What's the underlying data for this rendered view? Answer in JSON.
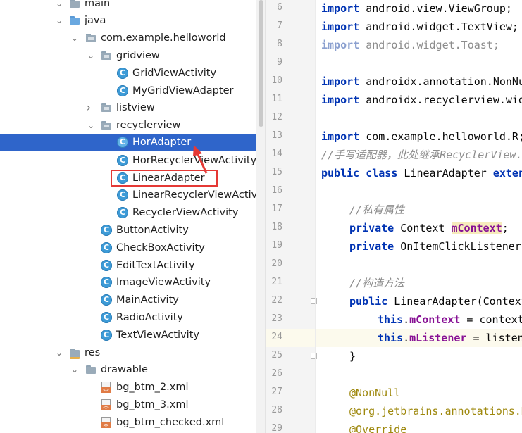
{
  "project_tree": {
    "items": [
      {
        "label": "main",
        "icon": "main-folder-icon",
        "expanded": true
      },
      {
        "label": "java",
        "icon": "java-source-folder-icon",
        "expanded": true
      },
      {
        "label": "com.example.helloworld",
        "icon": "package-icon",
        "expanded": true
      },
      {
        "label": "gridview",
        "icon": "package-icon",
        "expanded": true
      },
      {
        "label": "GridViewActivity",
        "icon": "class-icon"
      },
      {
        "label": "MyGridViewAdapter",
        "icon": "class-icon"
      },
      {
        "label": "listview",
        "icon": "package-icon",
        "expanded": false
      },
      {
        "label": "recyclerview",
        "icon": "package-icon",
        "expanded": true
      },
      {
        "label": "HorAdapter",
        "icon": "class-icon",
        "selected": true
      },
      {
        "label": "HorRecyclerViewActivity",
        "icon": "class-icon"
      },
      {
        "label": "LinearAdapter",
        "icon": "class-icon",
        "highlighted": true
      },
      {
        "label": "LinearRecyclerViewActivity",
        "icon": "class-icon"
      },
      {
        "label": "RecyclerViewActivity",
        "icon": "class-icon"
      },
      {
        "label": "ButtonActivity",
        "icon": "class-icon"
      },
      {
        "label": "CheckBoxActivity",
        "icon": "class-icon"
      },
      {
        "label": "EditTextActivity",
        "icon": "class-icon"
      },
      {
        "label": "ImageViewActivity",
        "icon": "class-icon"
      },
      {
        "label": "MainActivity",
        "icon": "class-icon"
      },
      {
        "label": "RadioActivity",
        "icon": "class-icon"
      },
      {
        "label": "TextViewActivity",
        "icon": "class-icon"
      },
      {
        "label": "res",
        "icon": "res-folder-icon",
        "expanded": true
      },
      {
        "label": "drawable",
        "icon": "folder-icon",
        "expanded": true
      },
      {
        "label": "bg_btm_2.xml",
        "icon": "xml-file-icon"
      },
      {
        "label": "bg_btm_3.xml",
        "icon": "xml-file-icon"
      },
      {
        "label": "bg_btm_checked.xml",
        "icon": "xml-file-icon"
      }
    ],
    "class_icon_letter": "C",
    "xml_icon_text": "<>",
    "chevron_expanded": "⌄",
    "chevron_collapsed": "›"
  },
  "editor": {
    "current_line": "24",
    "lines": [
      {
        "num": "6",
        "text": "import android.view.ViewGroup;"
      },
      {
        "num": "7",
        "text": "import android.widget.TextView;"
      },
      {
        "num": "8",
        "text": "import android.widget.Toast;"
      },
      {
        "num": "9",
        "text": ""
      },
      {
        "num": "10",
        "text": "import androidx.annotation.NonNull;"
      },
      {
        "num": "11",
        "text": "import androidx.recyclerview.widget.RecyclerView;"
      },
      {
        "num": "12",
        "text": ""
      },
      {
        "num": "13",
        "text": "import com.example.helloworld.R;"
      },
      {
        "num": "14",
        "text": "//手写适配器，此处继承RecyclerView.Adapter"
      },
      {
        "num": "15",
        "text": "public class LinearAdapter extends RecyclerView.Adapter"
      },
      {
        "num": "16",
        "text": ""
      },
      {
        "num": "17",
        "text": "//私有属性"
      },
      {
        "num": "18",
        "text": "private Context mContext;"
      },
      {
        "num": "19",
        "text": "private OnItemClickListener mListener;"
      },
      {
        "num": "20",
        "text": ""
      },
      {
        "num": "21",
        "text": "//构造方法"
      },
      {
        "num": "22",
        "text": "public LinearAdapter(Context context, OnItemClickListener listener){"
      },
      {
        "num": "23",
        "text": "this.mContext = context;"
      },
      {
        "num": "24",
        "text": "this.mListener = listener;"
      },
      {
        "num": "25",
        "text": "}"
      },
      {
        "num": "26",
        "text": ""
      },
      {
        "num": "27",
        "text": "@NonNull"
      },
      {
        "num": "28",
        "text": "@org.jetbrains.annotations.NotNull"
      },
      {
        "num": "29",
        "text": "@Override"
      }
    ]
  },
  "colors": {
    "selection": "#2f65ca",
    "keyword": "#0033b3",
    "field": "#871094",
    "comment": "#8c8c8c",
    "annotation": "#9e880d",
    "current_line": "#fcfaed",
    "annotation_mark": "#e53935"
  }
}
